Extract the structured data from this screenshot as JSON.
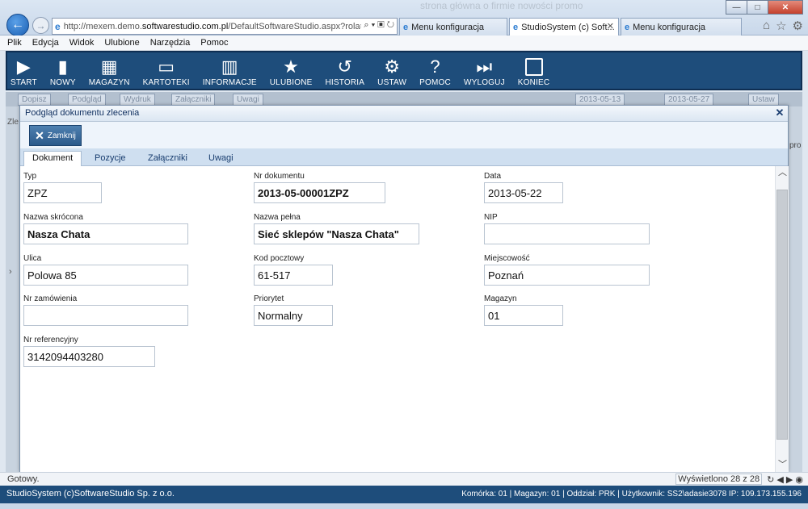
{
  "browser": {
    "back_glyph": "←",
    "forward_glyph": "→",
    "address_prefix": "http://mexem.demo.",
    "address_host": "softwarestudio.com.pl",
    "address_suffix": "/DefaultSoftwareStudio.aspx?rola=MI",
    "address_tools": "⌕ ▾ ▣ ↻",
    "ghost_text": "strona główna  o firmie  nowości  promo",
    "tabs": [
      {
        "label": "Menu konfiguracja",
        "active": false
      },
      {
        "label": "StudioSystem (c) Soft...",
        "active": true,
        "close": "✕"
      },
      {
        "label": "Menu konfiguracja",
        "active": false
      }
    ],
    "window_controls": {
      "minimize": "—",
      "maximize": "□",
      "close": "✕"
    },
    "right_icons": {
      "home": "⌂",
      "favorites": "☆",
      "settings": "⚙"
    }
  },
  "menubar": {
    "items": [
      "Plik",
      "Edycja",
      "Widok",
      "Ulubione",
      "Narzędzia",
      "Pomoc"
    ]
  },
  "app_toolbar": {
    "buttons": [
      {
        "label": "START",
        "icon": "play-icon",
        "glyph": "▶"
      },
      {
        "label": "NOWY",
        "icon": "document-icon",
        "glyph": "▮"
      },
      {
        "label": "MAGAZYN",
        "icon": "grid-icon",
        "glyph": "▦"
      },
      {
        "label": "KARTOTEKI",
        "icon": "monitor-icon",
        "glyph": "▭"
      },
      {
        "label": "INFORMACJE",
        "icon": "chart-icon",
        "glyph": "▥"
      },
      {
        "label": "ULUBIONE",
        "icon": "star-icon",
        "glyph": "★"
      },
      {
        "label": "HISTORIA",
        "icon": "history-icon",
        "glyph": "↺"
      },
      {
        "label": "USTAW",
        "icon": "gears-icon",
        "glyph": "⚙"
      },
      {
        "label": "POMOC",
        "icon": "help-icon",
        "glyph": "?"
      },
      {
        "label": "WYLOGUJ",
        "icon": "logout-icon",
        "glyph": "⏭"
      },
      {
        "label": "KONIEC",
        "icon": "stop-icon",
        "glyph": ""
      }
    ]
  },
  "background": {
    "buttons": [
      "Dopisz",
      "Podgląd",
      "Wydruk",
      "Załączniki",
      "Uwagi"
    ],
    "date_from": "2013-05-13",
    "date_to": "2013-05-27",
    "apply_label": "Ustaw",
    "side_label": "Zle",
    "right_text": "pro",
    "side_arrow": "›"
  },
  "dialog": {
    "title": "Podgląd dokumentu zlecenia",
    "close_glyph": "✕",
    "close_button_label": "Zamknij",
    "tabs": [
      {
        "label": "Dokument",
        "active": true
      },
      {
        "label": "Pozycje",
        "active": false
      },
      {
        "label": "Załączniki",
        "active": false
      },
      {
        "label": "Uwagi",
        "active": false
      }
    ],
    "fields": {
      "typ": {
        "label": "Typ",
        "value": "ZPZ"
      },
      "nr_dokumentu": {
        "label": "Nr dokumentu",
        "value": "2013-05-00001ZPZ"
      },
      "data": {
        "label": "Data",
        "value": "2013-05-22"
      },
      "nazwa_skrocona": {
        "label": "Nazwa skrócona",
        "value": "Nasza Chata"
      },
      "nazwa_pelna": {
        "label": "Nazwa pełna",
        "value": "Sieć sklepów \"Nasza Chata\""
      },
      "nip": {
        "label": "NIP",
        "value": ""
      },
      "ulica": {
        "label": "Ulica",
        "value": "Polowa 85"
      },
      "kod_pocztowy": {
        "label": "Kod pocztowy",
        "value": "61-517"
      },
      "miejscowosc": {
        "label": "Miejscowość",
        "value": "Poznań"
      },
      "nr_zamowienia": {
        "label": "Nr zamówienia",
        "value": ""
      },
      "priorytet": {
        "label": "Priorytet",
        "value": "Normalny"
      },
      "magazyn": {
        "label": "Magazyn",
        "value": "01"
      },
      "nr_referencyjny": {
        "label": "Nr referencyjny",
        "value": "3142094403280"
      }
    },
    "scroll_up": "︿",
    "scroll_down": "﹀"
  },
  "ie_status": {
    "text": "Gotowy.",
    "count": "Wyświetlono 28 z 28",
    "icons": "↻ ◀ ▶ ◉"
  },
  "app_status": {
    "left": "StudioSystem (c)SoftwareStudio Sp. z o.o.",
    "right": "Komórka: 01 | Magazyn: 01 | Oddział: PRK | Użytkownik: SS2\\adasie3078 IP: 109.173.155.196"
  },
  "colors": {
    "toolbar_bg": "#1e4d7b",
    "dialog_bg": "#eef4fb",
    "close_button_bg": "#2b5a8b"
  }
}
